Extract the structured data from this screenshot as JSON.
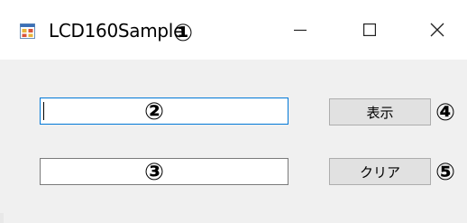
{
  "window": {
    "title": "LCD160Sample",
    "title_marker": "①",
    "app_icon": "windows-form-icon",
    "controls": {
      "minimize_icon": "minimize-icon",
      "maximize_icon": "maximize-icon",
      "close_icon": "close-icon"
    }
  },
  "form": {
    "textbox1": {
      "value": "",
      "marker": "②",
      "focused": true
    },
    "textbox2": {
      "value": "",
      "marker": "③"
    },
    "show_button": {
      "label": "表示",
      "marker": "④"
    },
    "clear_button": {
      "label": "クリア",
      "marker": "⑤"
    }
  },
  "colors": {
    "focus_border": "#0078d7",
    "button_face": "#e1e1e1",
    "form_background": "#f0f0f0"
  }
}
